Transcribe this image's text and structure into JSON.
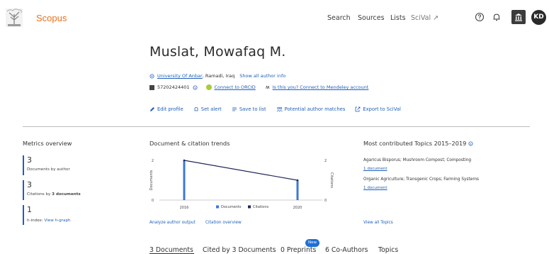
{
  "brand": {
    "name": "Scopus"
  },
  "nav": {
    "search": "Search",
    "sources": "Sources",
    "lists": "Lists",
    "scival": "SciVal ↗"
  },
  "user": {
    "initials": "KD"
  },
  "author": {
    "name": "Muslat, Mowafaq M.",
    "affiliation": "University Of Anbar",
    "location": ", Ramadi, Iraq",
    "show_all_info": "Show all author info",
    "author_id": "57202424401",
    "connect_orcid": "Connect to ORCID",
    "mendeley": "Is this you? Connect to Mendeley account"
  },
  "actions": {
    "edit_profile": "Edit profile",
    "set_alert": "Set alert",
    "save_to_list": "Save to list",
    "potential_matches": "Potential author matches",
    "export": "Export to SciVal"
  },
  "metrics": {
    "title": "Metrics overview",
    "documents_value": "3",
    "documents_label": "Documents by author",
    "citations_value": "3",
    "citations_label_pre": "Citations by ",
    "citations_label_bold": "3 documents",
    "hindex_value": "1",
    "hindex_label": "h-index:",
    "hindex_link": "View h-graph"
  },
  "trends": {
    "title": "Document & citation trends",
    "analyze_link": "Analyze author output",
    "citation_overview_link": "Citation overview"
  },
  "chart_data": {
    "type": "bar",
    "categories": [
      "2016",
      "2020"
    ],
    "series": [
      {
        "name": "Documents",
        "values": [
          2,
          1
        ]
      },
      {
        "name": "Citations",
        "values": [
          2,
          1
        ]
      }
    ],
    "ylabel": "Documents",
    "y2label": "Citations",
    "yticks": [
      "2",
      "1",
      "0"
    ],
    "y2ticks": [
      "2",
      "1",
      "0"
    ],
    "ylim": [
      0,
      2
    ],
    "colors": {
      "documents": "#3b78d8",
      "citations": "#1f2a5a"
    },
    "legend": "bottom"
  },
  "topics": {
    "title": "Most contributed Topics 2015–2019",
    "items": [
      {
        "name": "Agaricus Bisporus; Mushroom Compost; Composting",
        "count": "1 document"
      },
      {
        "name": "Organic Agriculture; Transgenic Crops; Farming Systems",
        "count": "1 document"
      }
    ],
    "view_all": "View all Topics"
  },
  "tabs": {
    "documents": "3 Documents",
    "cited_by": "Cited by 3 Documents",
    "preprints": "0 Preprints",
    "preprints_badge": "New",
    "coauthors": "6 Co-Authors",
    "topics": "Topics"
  }
}
